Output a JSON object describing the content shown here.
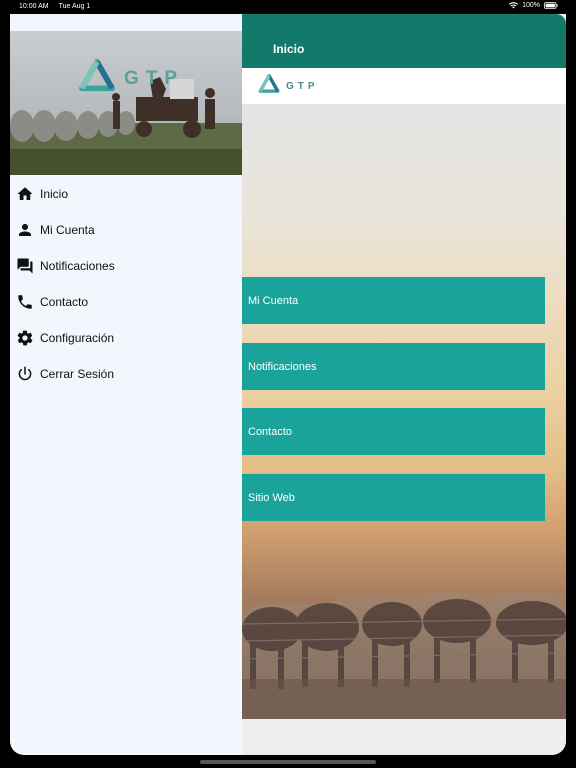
{
  "status_bar": {
    "time": "10:00 AM",
    "date": "Tue Aug 1",
    "battery": "100%",
    "wifi_icon": "wifi-icon",
    "battery_icon": "battery-icon"
  },
  "header": {
    "title": "Inicio"
  },
  "brand": {
    "logo_text": "GTP",
    "logo_icon": "gtp-logo-icon"
  },
  "drawer": {
    "items": [
      {
        "label": "Inicio",
        "icon": "home-icon"
      },
      {
        "label": "Mi Cuenta",
        "icon": "person-icon"
      },
      {
        "label": "Notificaciones",
        "icon": "chat-icon"
      },
      {
        "label": "Contacto",
        "icon": "phone-icon"
      },
      {
        "label": "Configuración",
        "icon": "gear-icon"
      },
      {
        "label": "Cerrar Sesión",
        "icon": "power-icon"
      }
    ]
  },
  "main": {
    "buttons": [
      {
        "label": "Mi Cuenta"
      },
      {
        "label": "Notificaciones"
      },
      {
        "label": "Contacto"
      },
      {
        "label": "Sitio Web"
      }
    ]
  },
  "colors": {
    "header_bg": "#127a6b",
    "button_bg": "#1aa39a",
    "drawer_bg": "#f1f7fd",
    "logo_teal": "#5e9e9a"
  }
}
